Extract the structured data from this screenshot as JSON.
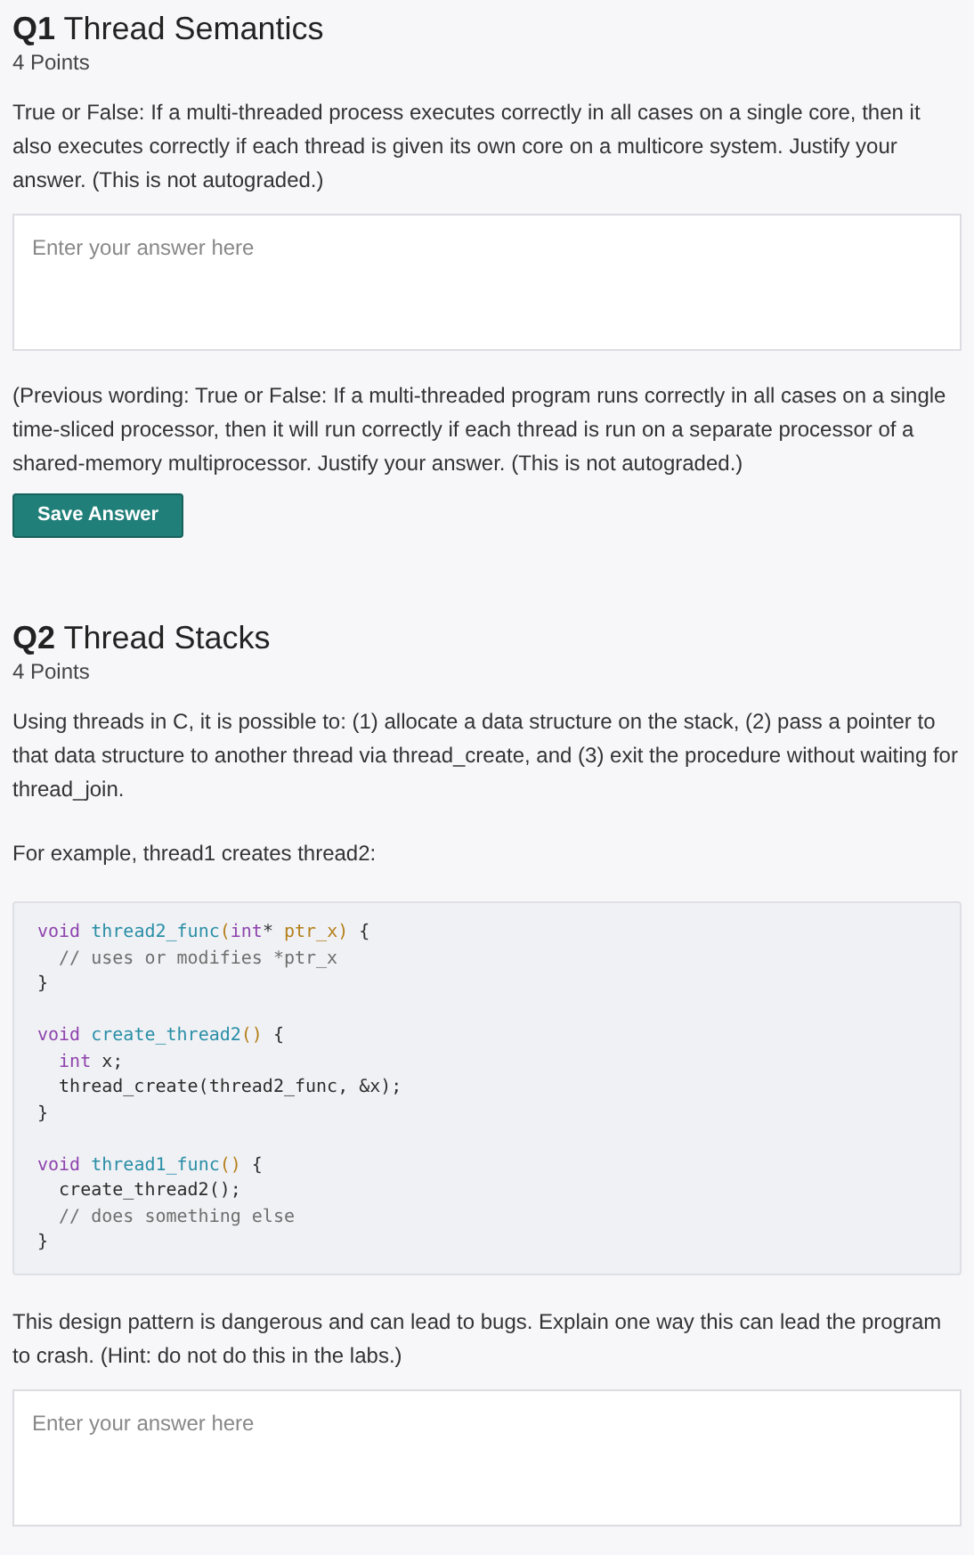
{
  "questions": [
    {
      "number": "Q1",
      "title": "Thread Semantics",
      "points": "4 Points",
      "blocks": [
        {
          "kind": "paragraph",
          "text": "True or False: If a multi-threaded process executes correctly in all cases on a single core, then it also executes correctly if each thread is given its own core on a multicore system.  Justify your answer. (This is not autograded.)"
        },
        {
          "kind": "answer",
          "placeholder": "Enter your answer here"
        },
        {
          "kind": "paragraph",
          "text": "(Previous wording: True or False: If a multi-threaded program runs correctly in all cases on a single time-sliced processor, then it will run correctly if each thread is run on a separate processor of a shared-memory multiprocessor.  Justify your answer. (This is not autograded.)"
        },
        {
          "kind": "button",
          "label": "Save Answer"
        }
      ]
    },
    {
      "number": "Q2",
      "title": "Thread Stacks",
      "points": "4 Points",
      "blocks": [
        {
          "kind": "paragraph",
          "text": "Using threads in C, it is possible to: (1) allocate a data structure on the stack, (2) pass a pointer to that data structure to another thread via thread_create, and (3) exit the procedure without waiting for thread_join."
        },
        {
          "kind": "paragraph",
          "text": "For example, thread1 creates thread2:"
        },
        {
          "kind": "code",
          "groups": [
            [
              [
                {
                  "text": "void ",
                  "kind": "keyword"
                },
                {
                  "text": "thread2_func",
                  "kind": "title"
                },
                {
                  "text": "(",
                  "kind": "param"
                },
                {
                  "text": "int",
                  "kind": "keyword"
                },
                {
                  "text": "* ",
                  "kind": "plain"
                },
                {
                  "text": "ptr_x",
                  "kind": "param"
                },
                {
                  "text": ")",
                  "kind": "param"
                },
                {
                  "text": " {",
                  "kind": "plain"
                }
              ],
              [
                {
                  "text": "  // uses or modifies *ptr_x",
                  "kind": "comment"
                }
              ],
              [
                {
                  "text": "}",
                  "kind": "plain"
                }
              ]
            ],
            [
              [
                {
                  "text": "void ",
                  "kind": "keyword"
                },
                {
                  "text": "create_thread2",
                  "kind": "title"
                },
                {
                  "text": "()",
                  "kind": "param"
                },
                {
                  "text": " {",
                  "kind": "plain"
                }
              ],
              [
                {
                  "text": "  int",
                  "kind": "keyword"
                },
                {
                  "text": " x;",
                  "kind": "plain"
                }
              ],
              [
                {
                  "text": "  thread_create(thread2_func, &x);",
                  "kind": "plain"
                }
              ],
              [
                {
                  "text": "}",
                  "kind": "plain"
                }
              ]
            ],
            [
              [
                {
                  "text": "void ",
                  "kind": "keyword"
                },
                {
                  "text": "thread1_func",
                  "kind": "title"
                },
                {
                  "text": "()",
                  "kind": "param"
                },
                {
                  "text": " {",
                  "kind": "plain"
                }
              ],
              [
                {
                  "text": "  create_thread2();",
                  "kind": "plain"
                }
              ],
              [
                {
                  "text": "  // does something else",
                  "kind": "comment"
                }
              ],
              [
                {
                  "text": "}",
                  "kind": "plain"
                }
              ]
            ]
          ]
        },
        {
          "kind": "paragraph",
          "text": "This design pattern is dangerous and can lead to bugs. Explain one way this can lead the program to crash. (Hint: do not do this in the labs.)"
        },
        {
          "kind": "answer",
          "placeholder": "Enter your answer here"
        }
      ]
    }
  ]
}
